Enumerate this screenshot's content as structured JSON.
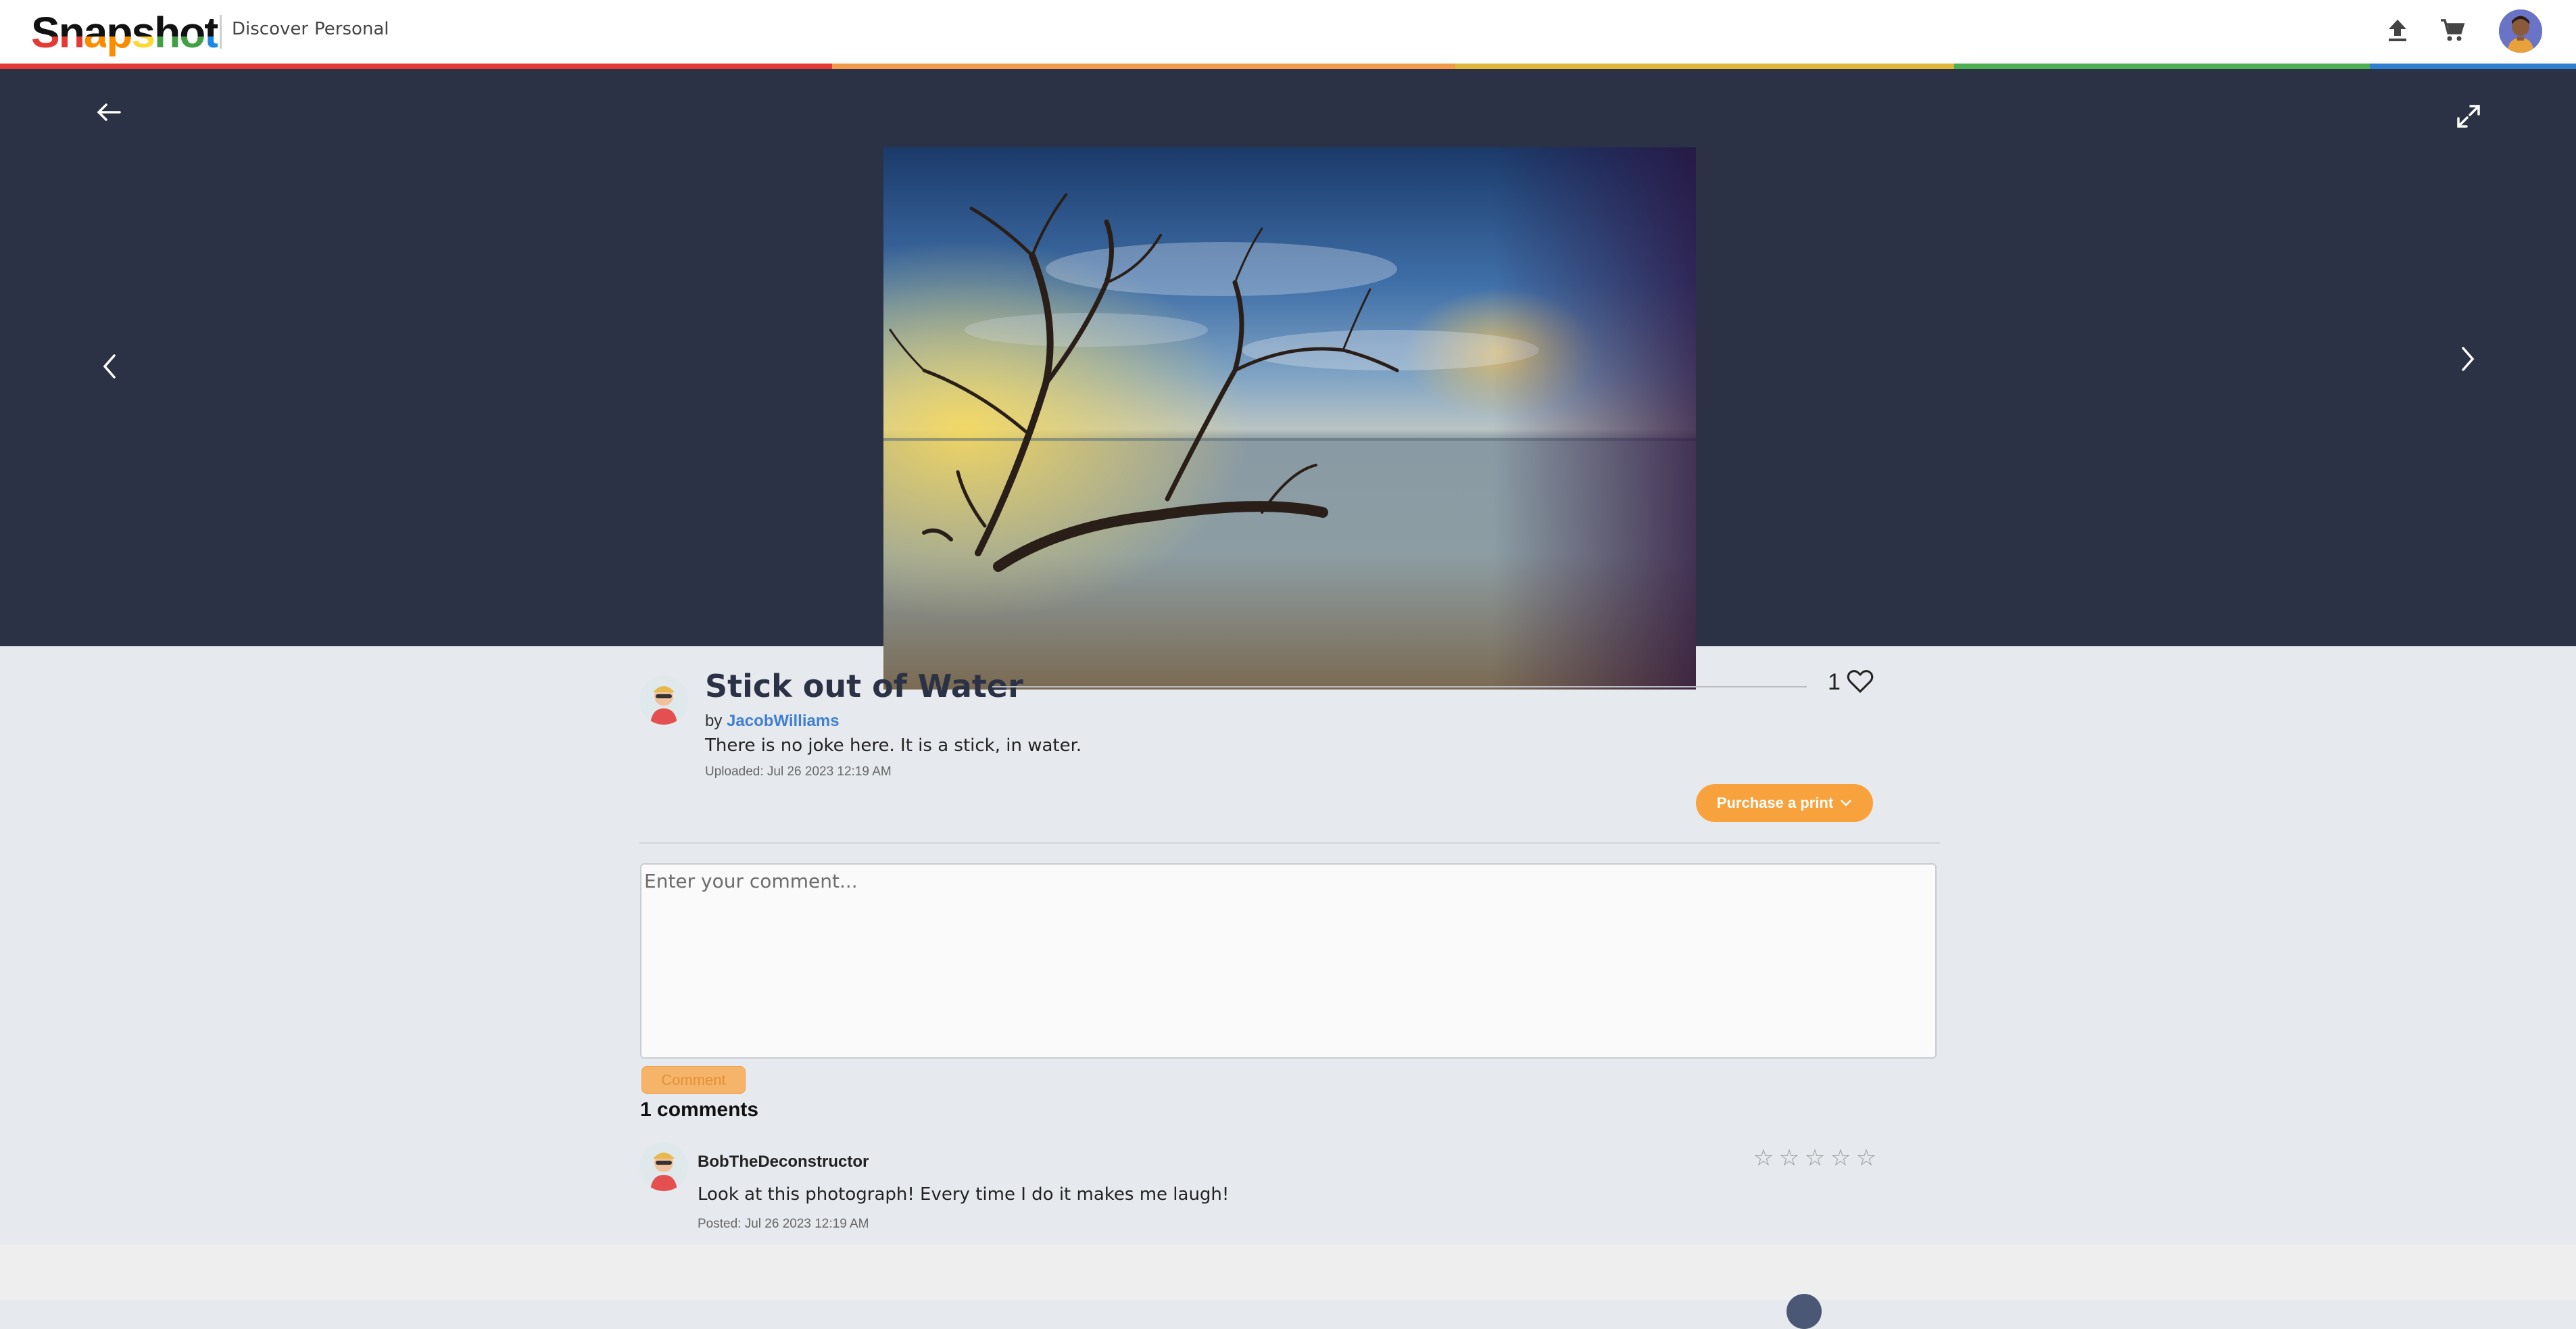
{
  "app": {
    "logo": "Snapshot",
    "logo_colors": [
      "#e53935",
      "#fb8c00",
      "#fdd835",
      "#43a047",
      "#1e88e5"
    ],
    "nav": [
      {
        "label": "Discover"
      },
      {
        "label": "Personal"
      }
    ],
    "icons": {
      "upload": "upload-icon",
      "cart": "cart-icon",
      "avatar": "user-avatar"
    },
    "rainbow_colors": [
      "#e53935",
      "#f2994a",
      "#e0b63b",
      "#4caf50",
      "#2f7fd1"
    ]
  },
  "viewer": {
    "background": "#2b3245",
    "icons": {
      "back": "arrow-left-icon",
      "expand": "expand-icon",
      "prev": "chevron-left-icon",
      "next": "chevron-right-icon"
    }
  },
  "photo": {
    "title": "Stick out of Water",
    "by_prefix": "by",
    "author": "JacobWilliams",
    "description": "There is no joke here. It is a stick, in water.",
    "uploaded": "Uploaded: Jul 26 2023 12:19 AM",
    "likes": "1",
    "purchase_label": "Purchase a print",
    "accent": "#f7a23d"
  },
  "comment_form": {
    "placeholder": "Enter your comment...",
    "submit_label": "Comment"
  },
  "comments": {
    "count_label": "1 comments",
    "items": [
      {
        "author": "BobTheDeconstructor",
        "text": "Look at this photograph! Every time I do it makes me laugh!",
        "posted": "Posted: Jul 26 2023 12:19 AM",
        "rating": 0,
        "rating_max": 5
      }
    ]
  }
}
